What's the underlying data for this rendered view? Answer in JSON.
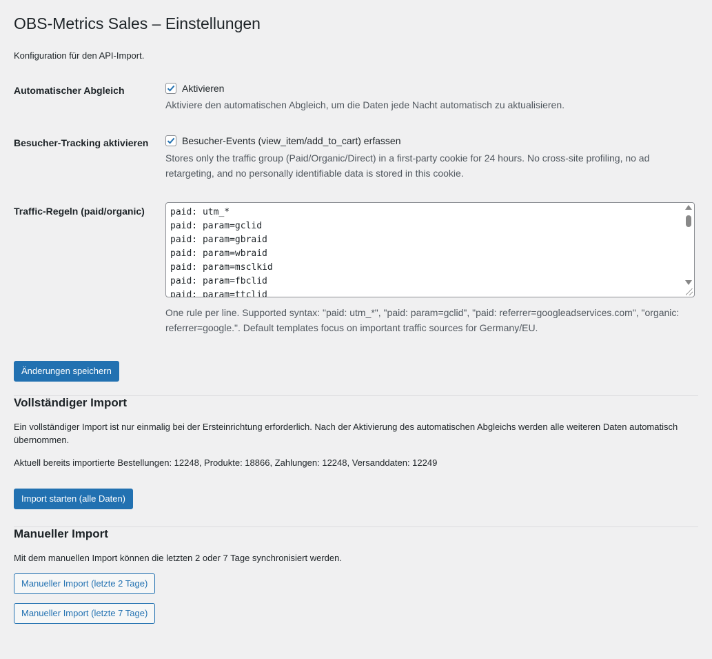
{
  "page": {
    "title": "OBS-Metrics Sales – Einstellungen",
    "intro": "Konfiguration für den API-Import."
  },
  "settings": {
    "auto_sync": {
      "label": "Automatischer Abgleich",
      "checkbox_label": "Aktivieren",
      "checked": true,
      "description": "Aktiviere den automatischen Abgleich, um die Daten jede Nacht automatisch zu aktualisieren."
    },
    "tracking": {
      "label": "Besucher-Tracking aktivieren",
      "checkbox_label": "Besucher-Events (view_item/add_to_cart) erfassen",
      "checked": true,
      "description": "Stores only the traffic group (Paid/Organic/Direct) in a first-party cookie for 24 hours. No cross-site profiling, no ad retargeting, and no personally identifiable data is stored in this cookie."
    },
    "rules": {
      "label": "Traffic-Regeln (paid/organic)",
      "lines": [
        "paid: utm_*",
        "paid: param=gclid",
        "paid: param=gbraid",
        "paid: param=wbraid",
        "paid: param=msclkid",
        "paid: param=fbclid",
        "paid: param=ttclid"
      ],
      "description": "One rule per line. Supported syntax: \"paid: utm_*\", \"paid: param=gclid\", \"paid: referrer=googleadservices.com\", \"organic: referrer=google.\". Default templates focus on important traffic sources for Germany/EU."
    },
    "save_label": "Änderungen speichern"
  },
  "full_import": {
    "title": "Vollständiger Import",
    "description": "Ein vollständiger Import ist nur einmalig bei der Ersteinrichtung erforderlich. Nach der Aktivierung des automatischen Abgleichs werden alle weiteren Daten automatisch übernommen.",
    "counts": "Aktuell bereits importierte Bestellungen: 12248, Produkte: 18866, Zahlungen: 12248, Versanddaten: 12249",
    "button_label": "Import starten (alle Daten)"
  },
  "manual_import": {
    "title": "Manueller Import",
    "description": "Mit dem manuellen Import können die letzten 2 oder 7 Tage synchronisiert werden.",
    "button_2_label": "Manueller Import (letzte 2 Tage)",
    "button_7_label": "Manueller Import (letzte 7 Tage)"
  },
  "colors": {
    "background": "#f0f0f1",
    "primary": "#2271b1",
    "text": "#1d2327",
    "muted": "#50575e"
  },
  "icons": {
    "checkbox_checked": "checkmark-icon"
  }
}
